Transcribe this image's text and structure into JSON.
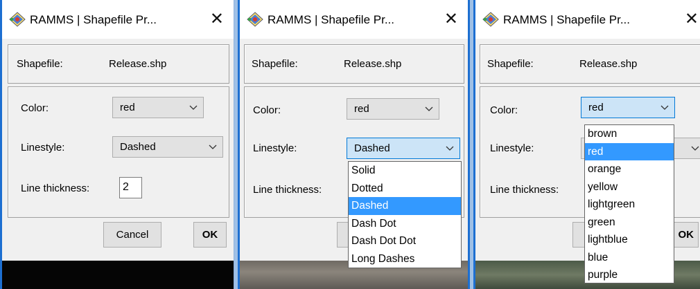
{
  "dialogs": [
    {
      "title": "RAMMS | Shapefile Pr...",
      "shapefile_label": "Shapefile:",
      "shapefile_value": "Release.shp",
      "color_label": "Color:",
      "color_value": "red",
      "linestyle_label": "Linestyle:",
      "linestyle_value": "Dashed",
      "thickness_label": "Line thickness:",
      "thickness_value": "2",
      "cancel_label": "Cancel",
      "ok_label": "OK"
    },
    {
      "title": "RAMMS | Shapefile Pr...",
      "shapefile_label": "Shapefile:",
      "shapefile_value": "Release.shp",
      "color_label": "Color:",
      "color_value": "red",
      "linestyle_label": "Linestyle:",
      "linestyle_value": "Dashed",
      "thickness_label": "Line thickness:",
      "linestyle_options": [
        "Solid",
        "Dotted",
        "Dashed",
        "Dash Dot",
        "Dash Dot Dot",
        "Long Dashes"
      ],
      "linestyle_selected": "Dashed"
    },
    {
      "title": "RAMMS | Shapefile Pr...",
      "shapefile_label": "Shapefile:",
      "shapefile_value": "Release.shp",
      "color_label": "Color:",
      "color_value": "red",
      "linestyle_label": "Linestyle:",
      "thickness_label": "Line thickness:",
      "ok_label_partial": "OK",
      "color_options": [
        "brown",
        "red",
        "orange",
        "yellow",
        "lightgreen",
        "green",
        "lightblue",
        "blue",
        "purple"
      ],
      "color_selected": "red"
    }
  ],
  "icons": {
    "app": "ramms-app-icon",
    "close": "close-icon",
    "dropdown": "chevron-down-icon"
  },
  "colors": {
    "accent": "#0078d7",
    "selection": "#3399ff",
    "desktop": "#9fc0e6"
  }
}
